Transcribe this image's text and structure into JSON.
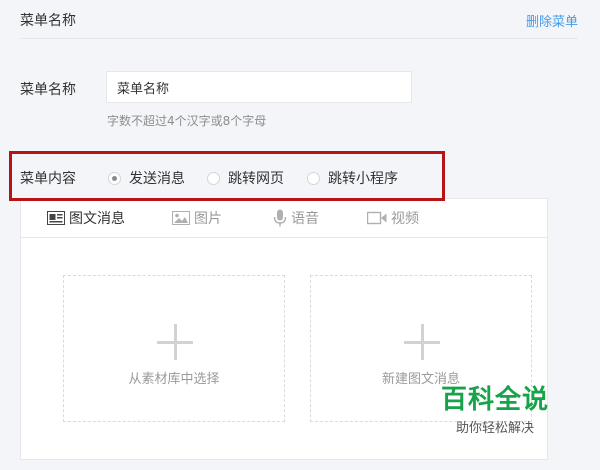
{
  "header": {
    "title": "菜单名称",
    "delete_label": "删除菜单"
  },
  "name_field": {
    "label": "菜单名称",
    "value": "菜单名称",
    "hint": "字数不超过4个汉字或8个字母"
  },
  "content": {
    "label": "菜单内容",
    "options": [
      {
        "label": "发送消息",
        "checked": true
      },
      {
        "label": "跳转网页",
        "checked": false
      },
      {
        "label": "跳转小程序",
        "checked": false
      }
    ]
  },
  "tabs": [
    {
      "label": "图文消息",
      "icon": "news-icon",
      "active": true
    },
    {
      "label": "图片",
      "icon": "image-icon",
      "active": false
    },
    {
      "label": "语音",
      "icon": "microphone-icon",
      "active": false
    },
    {
      "label": "视频",
      "icon": "video-icon",
      "active": false
    }
  ],
  "actions": {
    "choose_library": "从素材库中选择",
    "create_news": "新建图文消息"
  },
  "watermark": {
    "main": "百科全说",
    "sub": "助你轻松解决"
  },
  "colors": {
    "link": "#459ae9",
    "highlight": "#b81418",
    "watermark": "#16a34a"
  }
}
